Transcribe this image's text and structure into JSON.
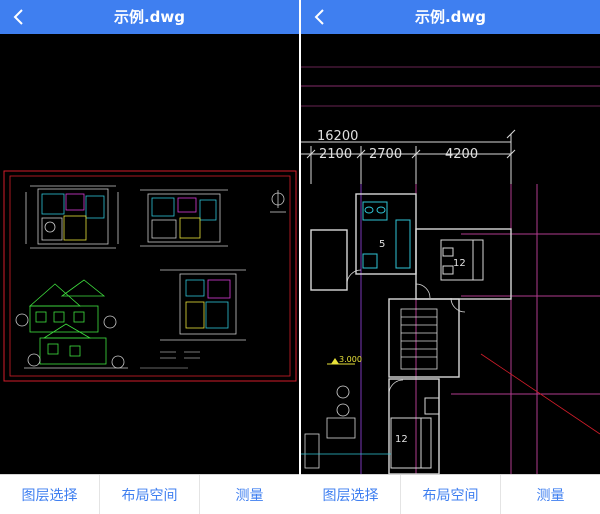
{
  "screens": [
    {
      "title": "示例.dwg",
      "toolbar": [
        "图层选择",
        "布局空间",
        "测量"
      ]
    },
    {
      "title": "示例.dwg",
      "toolbar": [
        "图层选择",
        "布局空间",
        "测量"
      ],
      "drawing": {
        "total_dimension": "16200",
        "dimensions": [
          "2100",
          "2700",
          "4200"
        ],
        "room_labels": [
          "5",
          "12",
          "12"
        ],
        "elevation_mark": "3.000"
      }
    }
  ],
  "colors": {
    "header": "#3f7ff0",
    "toolbar_text": "#3f7ff0",
    "canvas": "#000000"
  },
  "icons": [
    "back-icon",
    "back-icon"
  ]
}
